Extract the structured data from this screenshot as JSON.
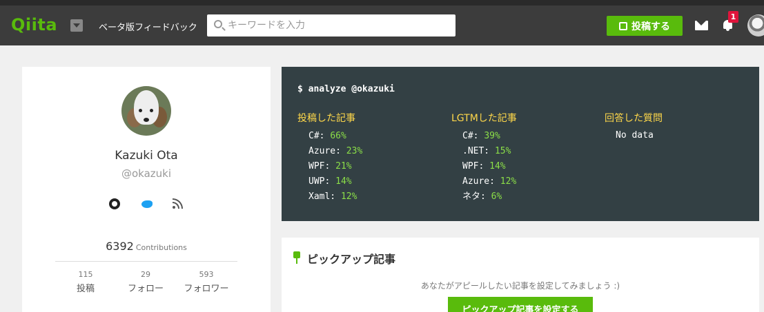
{
  "header": {
    "logo": "Qiita",
    "beta_link": "ベータ版フィードバック",
    "search_placeholder": "キーワードを入力",
    "search_value": "",
    "post_button": "投稿する",
    "notification_count": "1"
  },
  "profile": {
    "name": "Kazuki Ota",
    "handle": "@okazuki",
    "contributions_value": "6392",
    "contributions_label": "Contributions",
    "stats": [
      {
        "value": "115",
        "label": "投稿"
      },
      {
        "value": "29",
        "label": "フォロー"
      },
      {
        "value": "593",
        "label": "フォロワー"
      }
    ]
  },
  "analyze": {
    "command": "$ analyze @okazuki",
    "posted": {
      "title": "投稿した記事",
      "items": [
        {
          "name": "C#:",
          "pct": "66%"
        },
        {
          "name": "Azure:",
          "pct": "23%"
        },
        {
          "name": "WPF:",
          "pct": "21%"
        },
        {
          "name": "UWP:",
          "pct": "14%"
        },
        {
          "name": "Xaml:",
          "pct": "12%"
        }
      ]
    },
    "lgtm": {
      "title": "LGTMした記事",
      "items": [
        {
          "name": "C#:",
          "pct": "39%"
        },
        {
          "name": ".NET:",
          "pct": "15%"
        },
        {
          "name": "WPF:",
          "pct": "14%"
        },
        {
          "name": "Azure:",
          "pct": "12%"
        },
        {
          "name": "ネタ:",
          "pct": "6%"
        }
      ]
    },
    "answers": {
      "title": "回答した質問",
      "no_data": "No data"
    }
  },
  "pickup": {
    "title": "ピックアップ記事",
    "description": "あなたがアピールしたい記事を設定してみましょう :)",
    "button": "ピックアップ記事を設定する"
  },
  "colors": {
    "brand": "#59bb0c",
    "header_bg": "#3c3c3c",
    "analyze_bg": "#334044",
    "analyze_heading": "#ffd84a",
    "analyze_pct": "#8bde48",
    "badge": "#e0143c"
  }
}
